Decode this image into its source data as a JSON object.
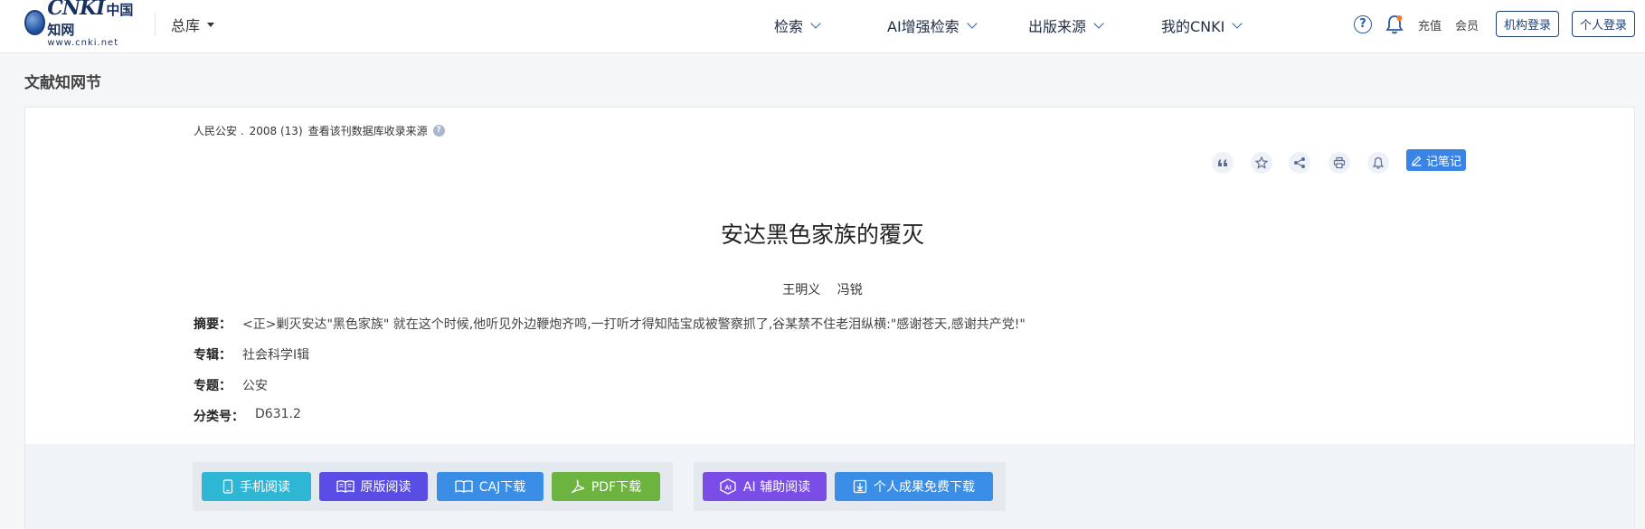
{
  "header": {
    "logo": {
      "main": "CNKI",
      "cn": "中国知网",
      "sub": "www.cnki.net"
    },
    "library_select": "总库",
    "nav": [
      "检索",
      "AI增强检索",
      "出版来源",
      "我的CNKI"
    ],
    "recharge": "充值",
    "member": "会员",
    "org_login": "机构登录",
    "personal_login": "个人登录"
  },
  "section_title": "文献知网节",
  "article": {
    "source": "人民公安 .",
    "issue": "2008 (13)",
    "source_link": "查看该刊数据库收录来源",
    "note_button": "记笔记",
    "title": "安达黑色家族的覆灭",
    "authors": [
      "王明义",
      "冯锐"
    ],
    "meta": [
      {
        "label": "摘要：",
        "value": "<正>剿灭安达\"黑色家族\" 就在这个时候,他听见外边鞭炮齐鸣,一打听才得知陆宝成被警察抓了,谷某禁不住老泪纵横:\"感谢苍天,感谢共产党!\""
      },
      {
        "label": "专辑：",
        "value": "社会科学Ⅰ辑"
      },
      {
        "label": "专题：",
        "value": "公安"
      },
      {
        "label": "分类号：",
        "value": "D631.2"
      }
    ]
  },
  "actions": {
    "mobile_read": "手机阅读",
    "original_read": "原版阅读",
    "caj_download": "CAJ下载",
    "pdf_download": "PDF下载",
    "ai_read": "AI 辅助阅读",
    "free_download": "个人成果免费下载"
  },
  "colors": {
    "mobile": "#2db7d4",
    "original": "#5a4de6",
    "caj": "#3a8ee6",
    "pdf": "#6db33f",
    "ai": "#7a4de6",
    "free": "#3a8ee6"
  }
}
